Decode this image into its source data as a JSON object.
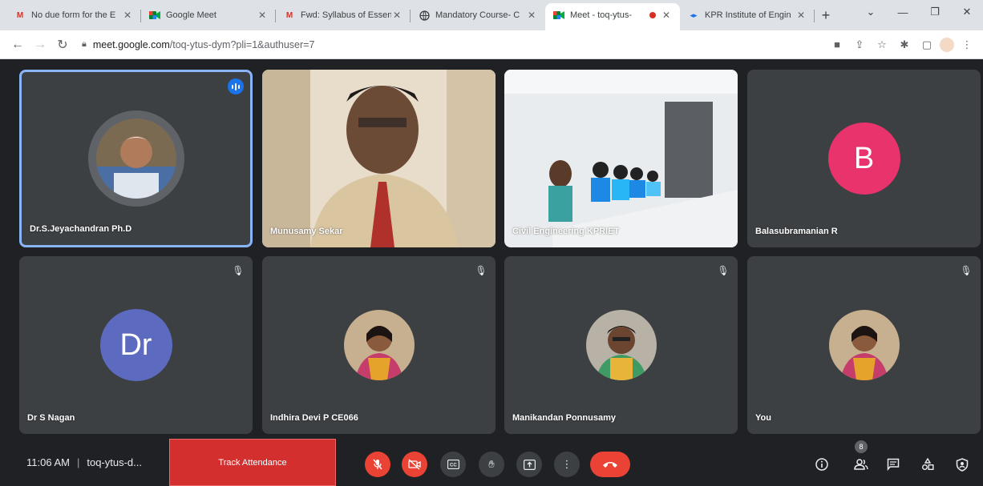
{
  "browser": {
    "tabs": [
      {
        "title": "No due form for the E",
        "favicon": "gmail-icon",
        "active": false
      },
      {
        "title": "Google Meet",
        "favicon": "meet-icon",
        "active": false
      },
      {
        "title": "Fwd: Syllabus of Essen",
        "favicon": "gmail-icon",
        "active": false
      },
      {
        "title": "Mandatory Course- C",
        "favicon": "globe-icon",
        "active": false
      },
      {
        "title": "Meet - toq-ytus-",
        "favicon": "meet-icon",
        "active": true
      },
      {
        "title": "KPR Institute of Engin",
        "favicon": "kpr-icon",
        "active": false
      }
    ],
    "url_host": "meet.google.com",
    "url_path": "/toq-ytus-dym?pli=1&authuser=7"
  },
  "participants": [
    {
      "name": "Dr.S.Jeyachandran Ph.D",
      "kind": "photo",
      "speaking": true
    },
    {
      "name": "Munusamy Sekar",
      "kind": "video"
    },
    {
      "name": "Civil Engineering KPRIET",
      "kind": "video"
    },
    {
      "name": "Balasubramanian R",
      "kind": "letter",
      "letter": "B",
      "color": "#e8336d"
    },
    {
      "name": "Dr S Nagan",
      "kind": "letter",
      "letter": "Dr",
      "color": "#5c6bc0"
    },
    {
      "name": "Indhira Devi P CE066",
      "kind": "photo"
    },
    {
      "name": "Manikandan Ponnusamy",
      "kind": "photo"
    },
    {
      "name": "You",
      "kind": "photo"
    }
  ],
  "meeting": {
    "time": "11:06 AM",
    "code": "toq-ytus-d...",
    "track_attendance": "Track Attendance",
    "people_count": "8"
  },
  "colors": {
    "accent_red": "#ea4335",
    "speaking_border": "#8ab4f8",
    "tile_bg": "#3c4043"
  }
}
